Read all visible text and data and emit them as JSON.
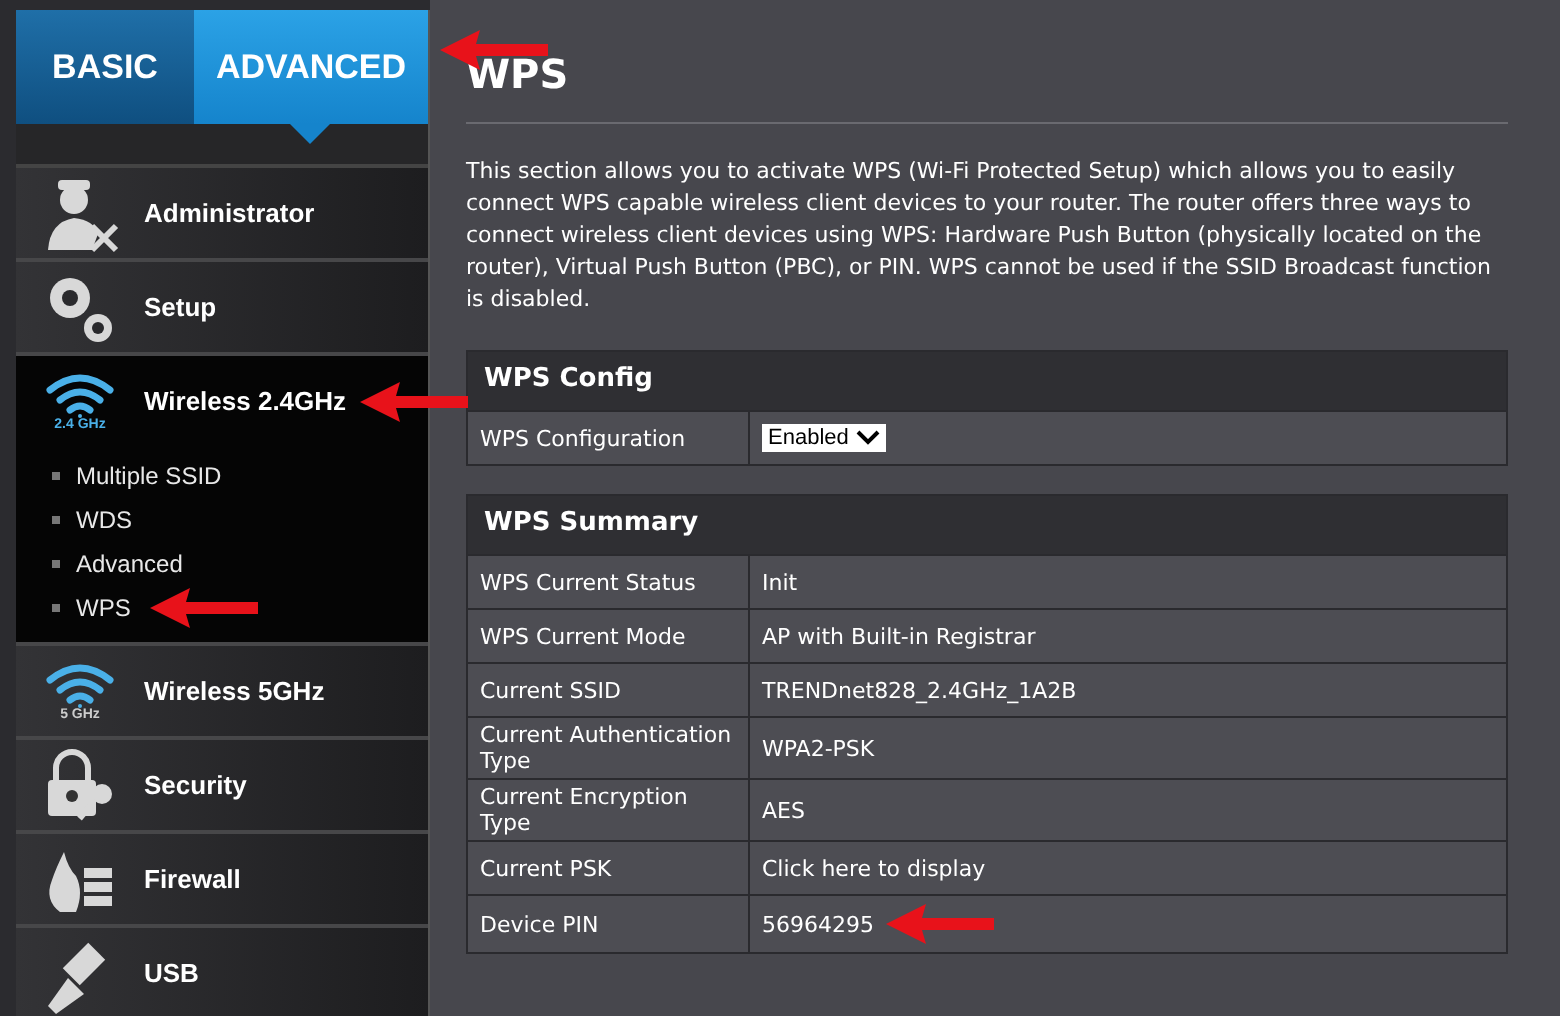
{
  "mode_tabs": [
    {
      "label": "BASIC",
      "selected": false
    },
    {
      "label": "ADVANCED",
      "selected": true,
      "annotated": true
    }
  ],
  "sidebar": {
    "items": [
      {
        "label": "Administrator",
        "expanded": false
      },
      {
        "label": "Setup",
        "expanded": false
      },
      {
        "label": "Wireless 2.4GHz",
        "icon_caption": "2.4 GHz",
        "expanded": true,
        "annotated": true,
        "children": [
          {
            "label": "Multiple SSID"
          },
          {
            "label": "WDS"
          },
          {
            "label": "Advanced"
          },
          {
            "label": "WPS",
            "annotated": true
          }
        ]
      },
      {
        "label": "Wireless 5GHz",
        "icon_caption": "5 GHz",
        "expanded": false
      },
      {
        "label": "Security",
        "expanded": false
      },
      {
        "label": "Firewall",
        "expanded": false
      },
      {
        "label": "USB",
        "expanded": false
      }
    ]
  },
  "page": {
    "title": "WPS",
    "description": "This section allows you to activate WPS (Wi-Fi Protected Setup) which allows you to easily connect WPS capable wireless client devices to your router. The router offers three ways to connect wireless client devices using WPS: Hardware Push Button (physically located on the router), Virtual Push Button (PBC), or PIN. WPS cannot be used if the SSID Broadcast function is disabled."
  },
  "sections": [
    {
      "title": "WPS Config",
      "rows": [
        {
          "label": "WPS Configuration",
          "kind": "select",
          "value": "Enabled"
        }
      ]
    },
    {
      "title": "WPS Summary",
      "rows": [
        {
          "label": "WPS Current Status",
          "kind": "text",
          "value": "Init"
        },
        {
          "label": "WPS Current Mode",
          "kind": "text",
          "value": "AP with Built-in Registrar"
        },
        {
          "label": "Current SSID",
          "kind": "text",
          "value": "TRENDnet828_2.4GHz_1A2B"
        },
        {
          "label": "Current Authentication Type",
          "kind": "text",
          "value": "WPA2-PSK"
        },
        {
          "label": "Current Encryption Type",
          "kind": "text",
          "value": "AES"
        },
        {
          "label": "Current PSK",
          "kind": "link",
          "value": "Click here to display"
        },
        {
          "label": "Device PIN",
          "kind": "text",
          "value": "56964295",
          "annotated": true
        }
      ]
    }
  ]
}
